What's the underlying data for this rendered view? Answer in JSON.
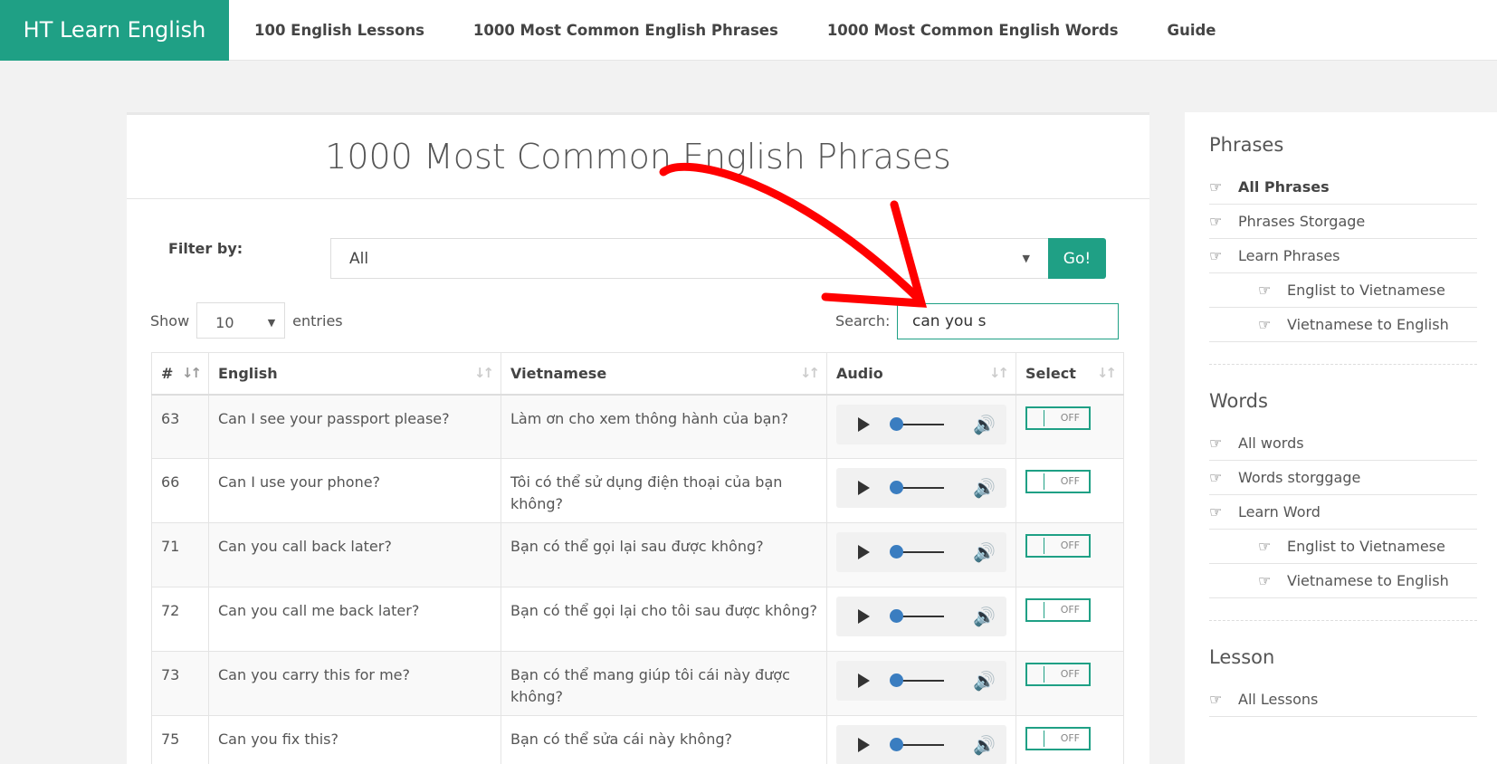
{
  "nav": {
    "brand": "HT Learn English",
    "links": [
      "100 English Lessons",
      "1000 Most Common English Phrases",
      "1000 Most Common English Words",
      "Guide"
    ]
  },
  "main": {
    "title": "1000 Most Common English Phrases",
    "filter_label": "Filter by:",
    "filter_value": "All",
    "go_label": "Go!",
    "show_label": "Show",
    "entries_value": "10",
    "entries_label": "entries",
    "search_label": "Search:",
    "search_value": "can you s",
    "columns": [
      "#",
      "English",
      "Vietnamese",
      "Audio",
      "Select"
    ],
    "toggle_label": "OFF",
    "rows": [
      {
        "id": "63",
        "en": "Can I see your passport please?",
        "vi": "Làm ơn cho xem thông hành của bạn?"
      },
      {
        "id": "66",
        "en": "Can I use your phone?",
        "vi": "Tôi có thể sử dụng điện thoại của bạn không?"
      },
      {
        "id": "71",
        "en": "Can you call back later?",
        "vi": "Bạn có thể gọi lại sau được không?"
      },
      {
        "id": "72",
        "en": "Can you call me back later?",
        "vi": "Bạn có thể gọi lại cho tôi sau được không?"
      },
      {
        "id": "73",
        "en": "Can you carry this for me?",
        "vi": "Bạn có thể mang giúp tôi cái này được không?"
      },
      {
        "id": "75",
        "en": "Can you fix this?",
        "vi": "Bạn có thể sửa cái này không?"
      }
    ]
  },
  "sidebar": {
    "phrases": {
      "title": "Phrases",
      "items": [
        "All Phrases",
        "Phrases Storgage",
        "Learn Phrases"
      ],
      "subitems": [
        "Englist to Vietnamese",
        "Vietnamese to English"
      ]
    },
    "words": {
      "title": "Words",
      "items": [
        "All words",
        "Words storggage",
        "Learn Word"
      ],
      "subitems": [
        "Englist to Vietnamese",
        "Vietnamese to English"
      ]
    },
    "lesson": {
      "title": "Lesson",
      "items": [
        "All Lessons"
      ]
    }
  },
  "colors": {
    "accent": "#1fa085",
    "annotation": "#ff0000"
  },
  "icons": {
    "sidebar": "hand-pointer-icon",
    "play": "play-icon",
    "volume": "volume-icon",
    "sort": "sort-icon"
  }
}
